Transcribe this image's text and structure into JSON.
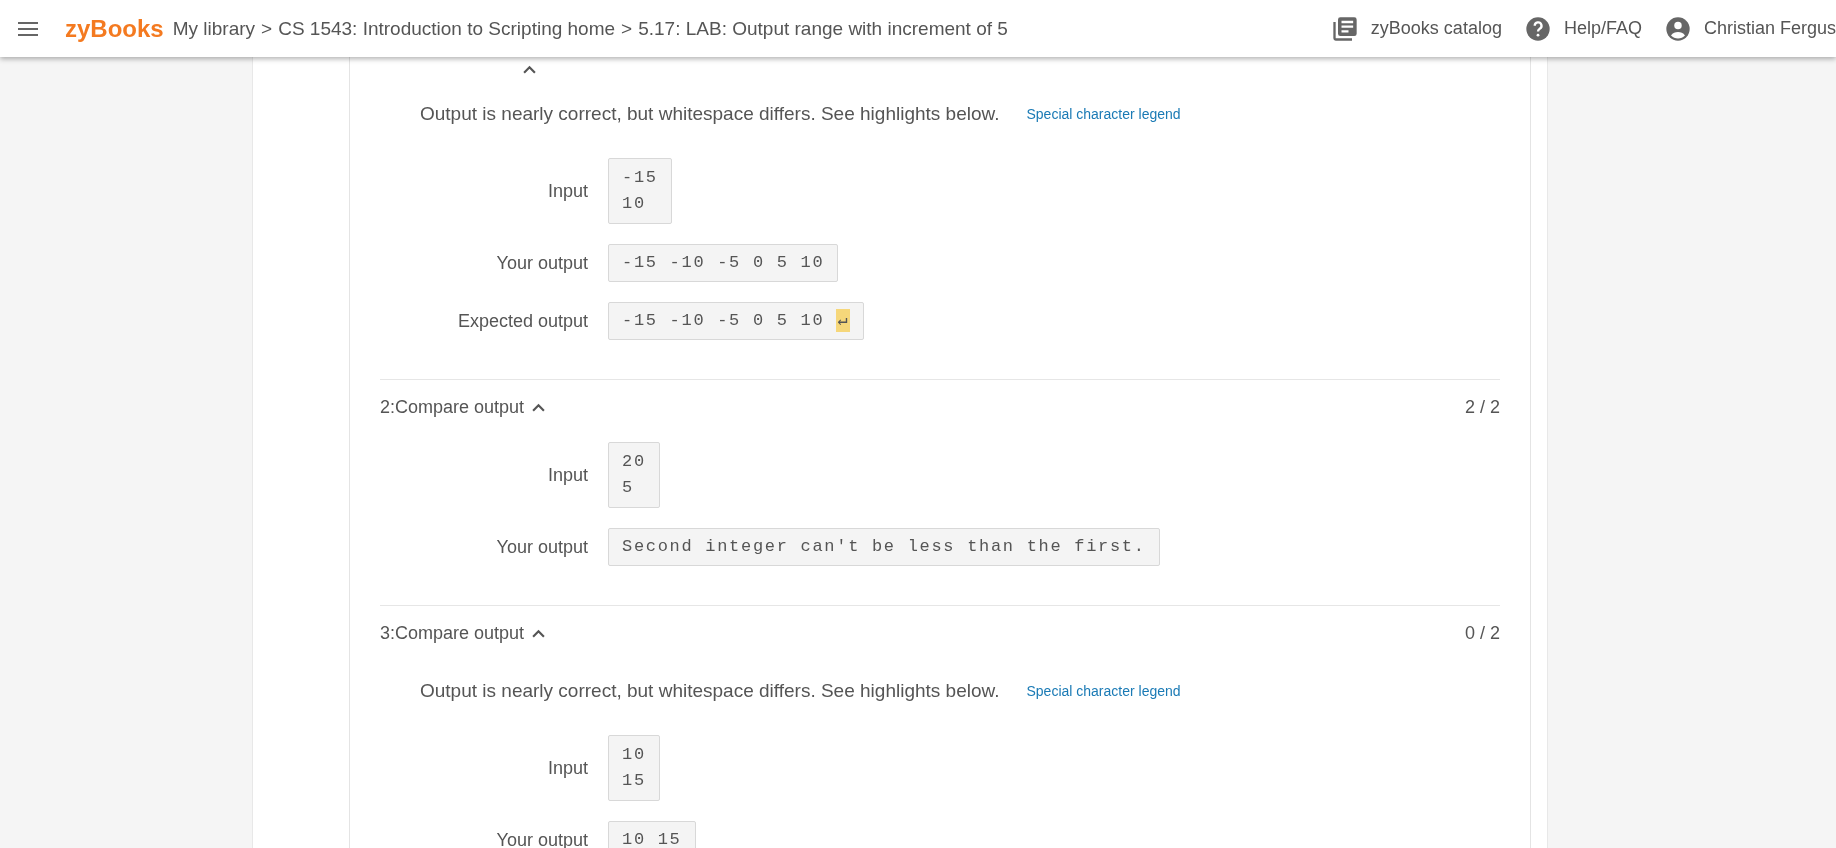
{
  "top_bar": {
    "logo": "zyBooks",
    "breadcrumb": [
      "My library",
      "CS 1543: Introduction to Scripting home",
      "5.17: LAB: Output range with increment of 5"
    ],
    "separator": ">",
    "links": [
      {
        "kind": "catalog",
        "label": "zyBooks catalog"
      },
      {
        "kind": "help",
        "label": "Help/FAQ"
      },
      {
        "kind": "user",
        "label": "Christian Fergus"
      }
    ]
  },
  "tests": [
    {
      "expanded": true,
      "message": "Output is nearly correct, but whitespace differs. See highlights below.",
      "legend_link": "Special character legend",
      "rows": [
        {
          "kind": "input",
          "label": "Input",
          "lines": [
            "-15",
            "10"
          ]
        },
        {
          "kind": "output",
          "label": "Your output",
          "text": "-15 -10 -5 0 5 10"
        },
        {
          "kind": "output",
          "label": "Expected output",
          "text": "-15 -10 -5 0 5 10 ",
          "highlight": "↵"
        }
      ]
    },
    {
      "title": "2:Compare output",
      "expanded": true,
      "score": "2 / 2",
      "rows": [
        {
          "kind": "input",
          "label": "Input",
          "lines": [
            "20",
            "5"
          ]
        },
        {
          "kind": "output",
          "label": "Your output",
          "text": "Second integer can't be less than the first."
        }
      ]
    },
    {
      "title": "3:Compare output",
      "expanded": true,
      "score": "0 / 2",
      "message": "Output is nearly correct, but whitespace differs. See highlights below.",
      "legend_link": "Special character legend",
      "rows": [
        {
          "kind": "input",
          "label": "Input",
          "lines": [
            "10",
            "15"
          ]
        },
        {
          "kind": "output",
          "label": "Your output",
          "text": "10 15"
        }
      ]
    }
  ]
}
